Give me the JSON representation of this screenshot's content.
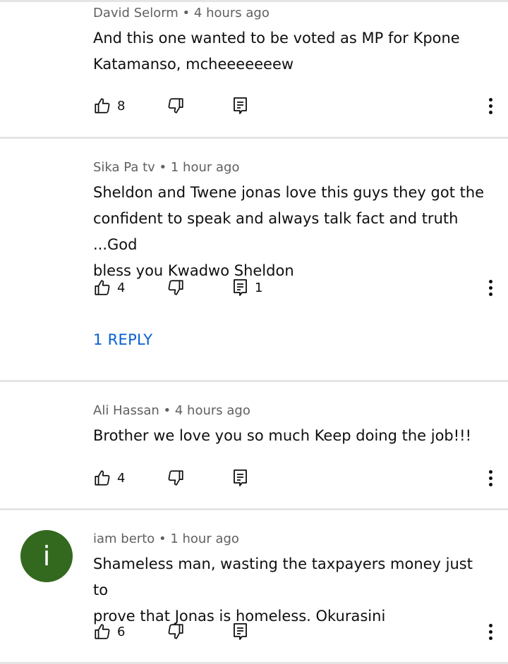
{
  "comments": [
    {
      "author": "David Selorm",
      "time": "4 hours ago",
      "text_lines": [
        "And this one wanted to be voted as MP for Kpone",
        "Katamanso, mcheeeeeeew"
      ],
      "likes": "8",
      "replies_count": ""
    },
    {
      "author": "Sika Pa tv",
      "time": "1 hour ago",
      "text_lines": [
        "Sheldon and Twene jonas love this guys they got the",
        "confident to speak and always talk fact and truth ...God",
        "bless you Kwadwo Sheldon"
      ],
      "likes": "4",
      "replies_count": "1",
      "replies_link": "1 REPLY"
    },
    {
      "author": "Ali Hassan",
      "time": "4 hours ago",
      "text_lines": [
        "Brother we love you so much Keep doing the job!!!"
      ],
      "likes": "4",
      "replies_count": ""
    },
    {
      "author": "iam berto",
      "time": "1 hour ago",
      "avatar_letter": "i",
      "avatar_color": "#33691e",
      "text_lines": [
        "Shameless man, wasting the taxpayers money just to",
        "prove that Jonas is homeless. Okurasini"
      ],
      "likes": "6",
      "replies_count": ""
    }
  ],
  "separator": " • ",
  "icons": {
    "like": "thumbs-up-icon",
    "dislike": "thumbs-down-icon",
    "reply": "reply-icon",
    "more": "more-vertical-icon"
  },
  "colors": {
    "link": "#065fd4",
    "meta": "#606060",
    "divider": "#e5e5e5"
  }
}
